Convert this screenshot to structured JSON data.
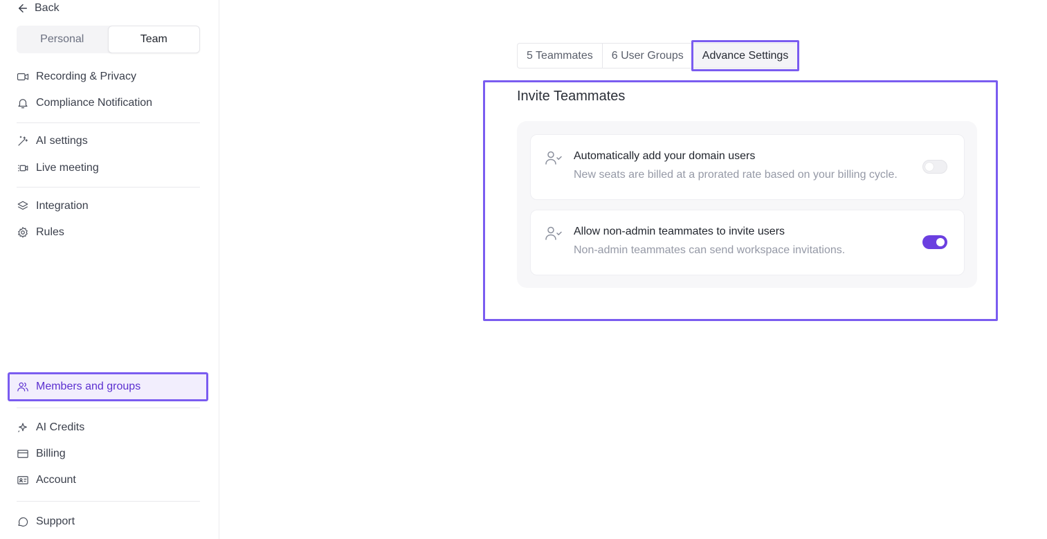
{
  "sidebar": {
    "back_label": "Back",
    "segments": {
      "personal": "Personal",
      "team": "Team"
    },
    "items": {
      "recording": "Recording & Privacy",
      "compliance": "Compliance Notification",
      "ai_settings": "AI settings",
      "live_meeting": "Live meeting",
      "integration": "Integration",
      "rules": "Rules",
      "members": "Members and groups",
      "ai_credits": "AI Credits",
      "billing": "Billing",
      "account": "Account",
      "support": "Support"
    }
  },
  "main": {
    "tabs": {
      "teammates": "5 Teammates",
      "user_groups": "6 User Groups",
      "advance": "Advance Settings"
    },
    "section_title": "Invite Teammates",
    "rows": [
      {
        "title": "Automatically add your domain users",
        "desc": "New seats are billed at a prorated rate based on your billing cycle.",
        "enabled": false
      },
      {
        "title": "Allow non-admin teammates to invite users",
        "desc": "Non-admin teammates can send workspace invitations.",
        "enabled": true
      }
    ]
  },
  "colors": {
    "accent": "#7a5cf0",
    "toggle_on": "#6b3fe0"
  }
}
